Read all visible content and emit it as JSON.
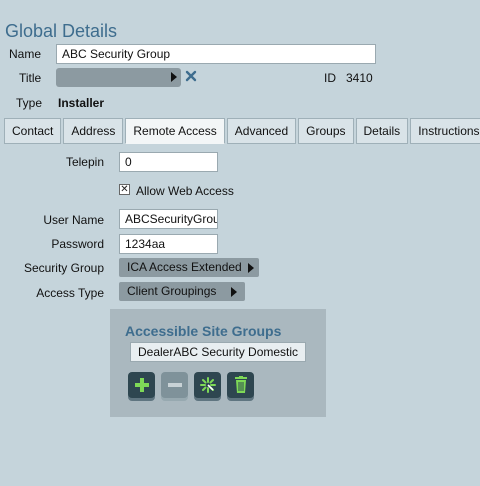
{
  "header": {
    "title": "Global Details"
  },
  "fields": {
    "name_label": "Name",
    "name_value": "ABC Security Group",
    "title_label": "Title",
    "id_label": "ID",
    "id_value": "3410",
    "type_label": "Type",
    "type_value": "Installer"
  },
  "tabs": [
    {
      "label": "Contact"
    },
    {
      "label": "Address"
    },
    {
      "label": "Remote Access",
      "active": true
    },
    {
      "label": "Advanced"
    },
    {
      "label": "Groups"
    },
    {
      "label": "Details"
    },
    {
      "label": "Instructions"
    }
  ],
  "remote_access": {
    "telepin_label": "Telepin",
    "telepin_value": "0",
    "allow_web_label": "Allow Web Access",
    "allow_web_checked": true,
    "username_label": "User Name",
    "username_value": "ABCSecurityGrou",
    "password_label": "Password",
    "password_value": "1234aa",
    "security_group_label": "Security Group",
    "security_group_value": "ICA Access Extended",
    "access_type_label": "Access Type",
    "access_type_value": "Client Groupings"
  },
  "site_groups": {
    "title": "Accessible Site Groups",
    "items": [
      "DealerABC Security Domestic"
    ],
    "icons": [
      "add-icon",
      "remove-icon",
      "sparkle-icon",
      "trash-icon"
    ]
  },
  "colors": {
    "accent": "#3e6d8e",
    "background": "#c5d4db",
    "button_dark": "#2e4650",
    "icon_green": "#7ed957"
  }
}
